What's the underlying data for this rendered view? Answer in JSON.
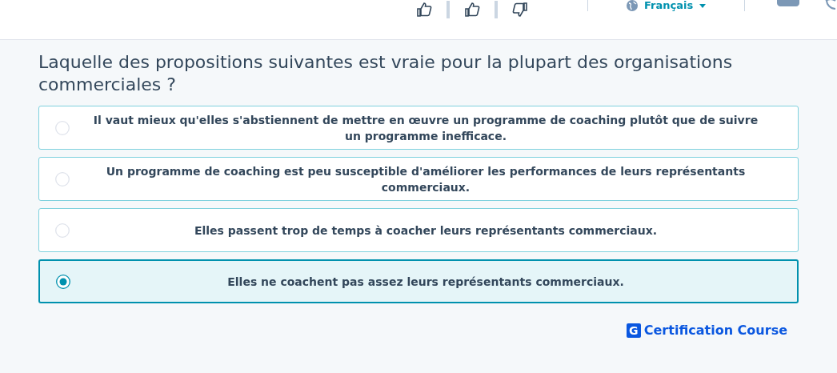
{
  "header": {
    "language": "Français"
  },
  "question": "Laquelle des propositions suivantes est vraie pour la plupart des organisations commerciales ?",
  "options": [
    {
      "text": "Il vaut mieux qu'elles s'abstiennent de mettre en œuvre un programme de coaching plutôt que de suivre un programme inefficace.",
      "selected": false
    },
    {
      "text": "Un programme de coaching est peu susceptible d'améliorer les performances de leurs représentants commerciaux.",
      "selected": false
    },
    {
      "text": "Elles passent trop de temps à coacher leurs représentants commerciaux.",
      "selected": false
    },
    {
      "text": "Elles ne coachent pas assez leurs représentants commerciaux.",
      "selected": true
    }
  ],
  "brand": {
    "letter": "G",
    "name": "Certification Course"
  }
}
